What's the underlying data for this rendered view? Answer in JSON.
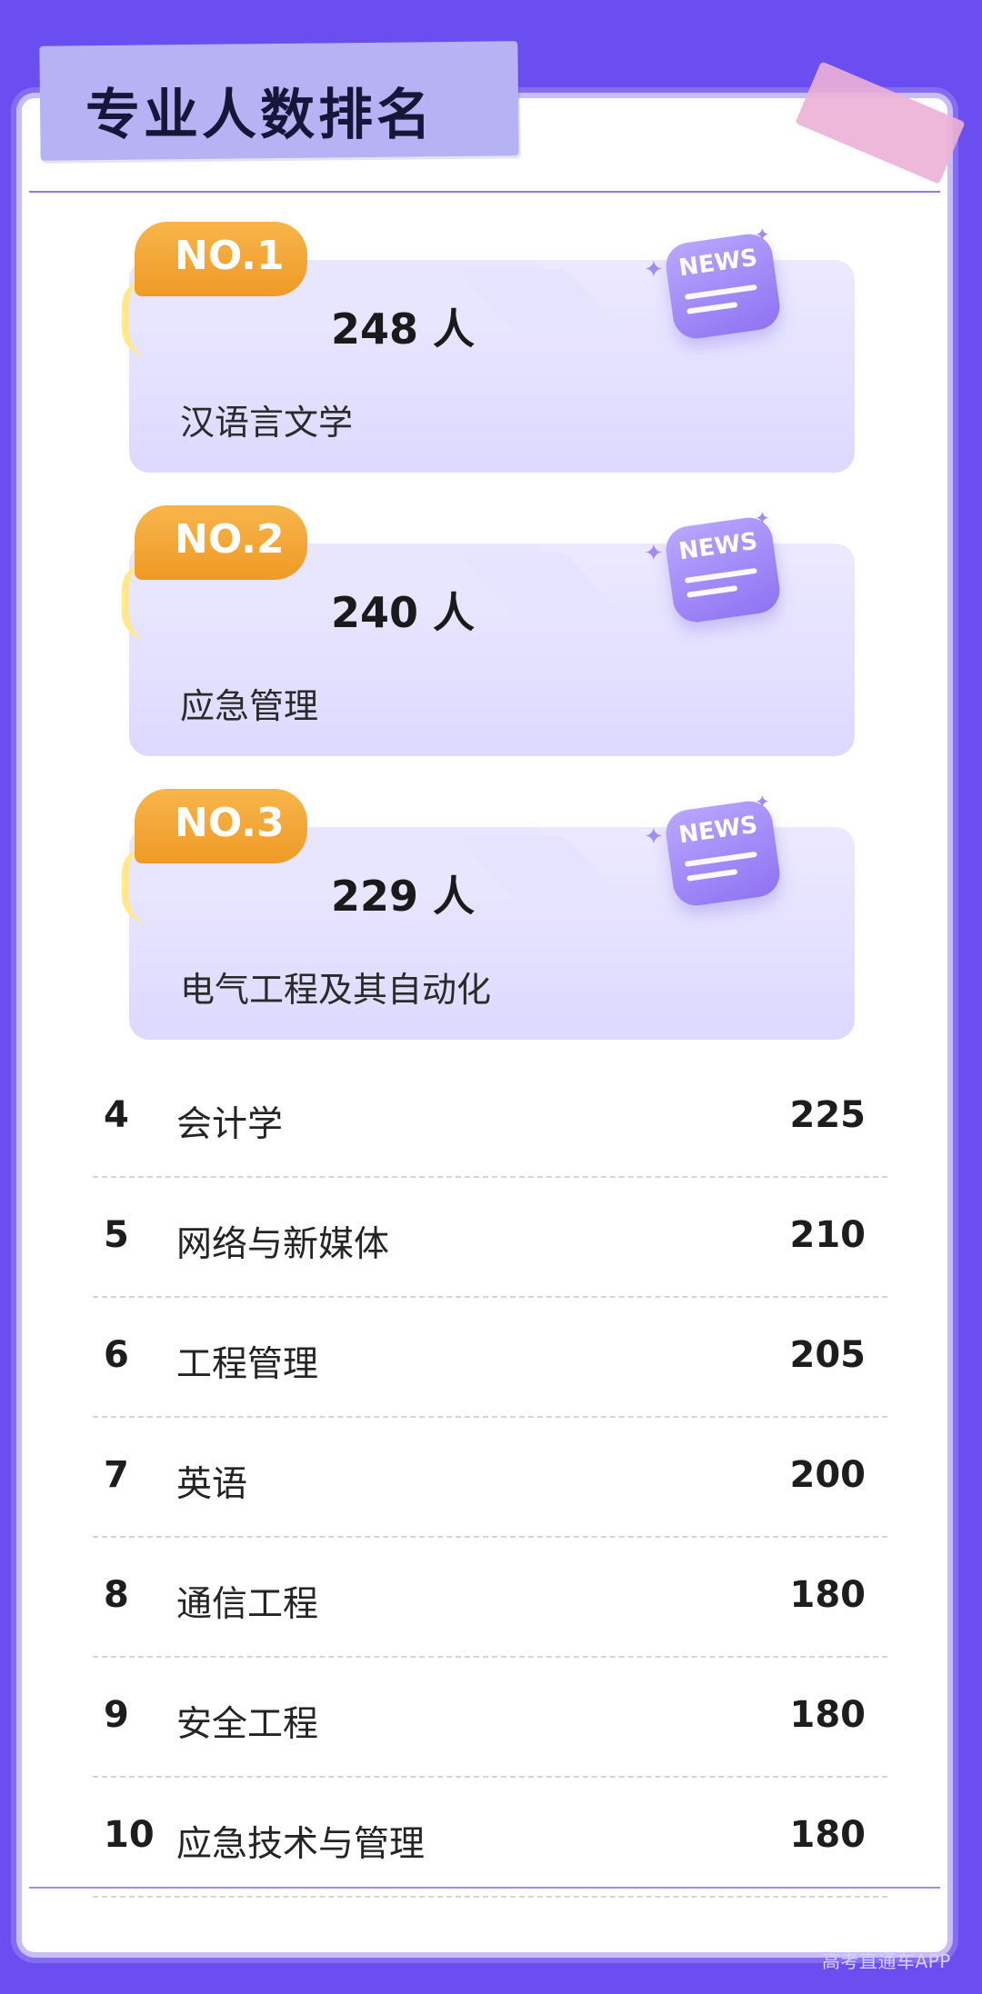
{
  "header": {
    "title": "专业人数排名"
  },
  "top3": [
    {
      "badge": "NO.1",
      "count": "248 人",
      "name": "汉语言文学"
    },
    {
      "badge": "NO.2",
      "count": "240 人",
      "name": "应急管理"
    },
    {
      "badge": "NO.3",
      "count": "229 人",
      "name": "电气工程及其自动化"
    }
  ],
  "news_icon_label": "NEWS",
  "rankings": [
    {
      "rank": "4",
      "name": "会计学",
      "value": "225"
    },
    {
      "rank": "5",
      "name": "网络与新媒体",
      "value": "210"
    },
    {
      "rank": "6",
      "name": "工程管理",
      "value": "205"
    },
    {
      "rank": "7",
      "name": "英语",
      "value": "200"
    },
    {
      "rank": "8",
      "name": "通信工程",
      "value": "180"
    },
    {
      "rank": "9",
      "name": "安全工程",
      "value": "180"
    },
    {
      "rank": "10",
      "name": "应急技术与管理",
      "value": "180"
    }
  ],
  "watermark": "高考直通车APP",
  "colors": {
    "background": "#6a4ef0",
    "paper": "#ffffff",
    "title_box": "#b6b2f3",
    "badge": "#f0a030",
    "card": "#e4e0ff",
    "news_icon": "#9d85f5"
  }
}
